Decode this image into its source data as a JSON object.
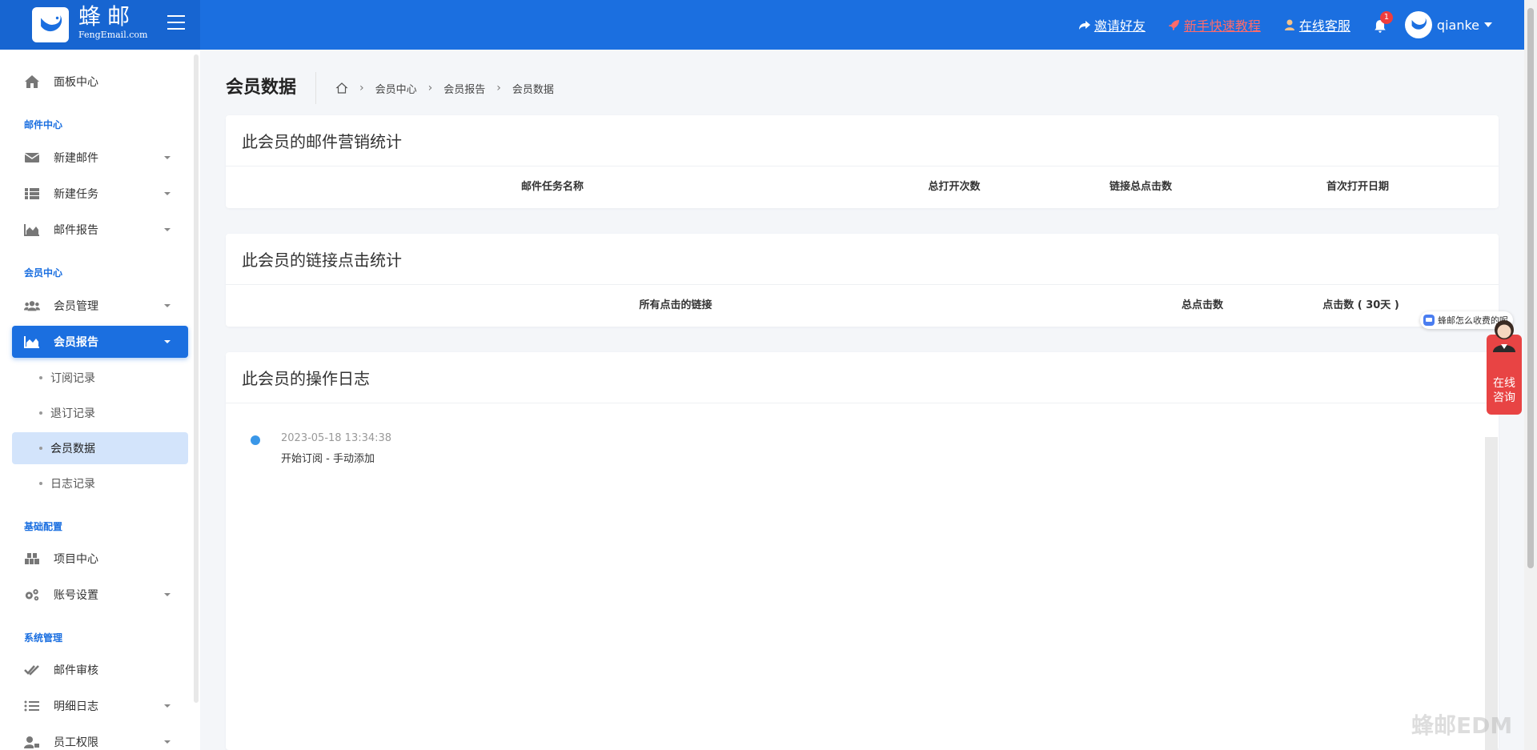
{
  "brand": {
    "name_cn": "蜂邮",
    "name_en": "FengEmail.com"
  },
  "header": {
    "links": [
      {
        "label": "邀请好友",
        "icon": "share-icon"
      },
      {
        "label": "新手快速教程",
        "icon": "rocket-icon",
        "color": "#ff6b6b"
      },
      {
        "label": "在线客服",
        "icon": "user-icon"
      }
    ],
    "notifications": "1",
    "username": "qianke"
  },
  "sidebar": {
    "dashboard": "面板中心",
    "sections": {
      "mail": "邮件中心",
      "member": "会员中心",
      "config": "基础配置",
      "system": "系统管理"
    },
    "items": {
      "new_mail": "新建邮件",
      "new_task": "新建任务",
      "mail_report": "邮件报告",
      "member_manage": "会员管理",
      "member_report": "会员报告",
      "project_center": "项目中心",
      "account_settings": "账号设置",
      "mail_review": "邮件审核",
      "detail_log": "明细日志",
      "staff_permission": "员工权限"
    },
    "subitems": {
      "subscribe_records": "订阅记录",
      "unsubscribe_records": "退订记录",
      "member_data": "会员数据",
      "log_records": "日志记录"
    }
  },
  "page": {
    "title": "会员数据",
    "breadcrumb": [
      "会员中心",
      "会员报告",
      "会员数据"
    ]
  },
  "cards": {
    "mail_stats": {
      "title": "此会员的邮件营销统计",
      "columns": [
        "邮件任务名称",
        "总打开次数",
        "链接总点击数",
        "首次打开日期"
      ]
    },
    "link_stats": {
      "title": "此会员的链接点击统计",
      "columns": [
        "所有点击的链接",
        "总点击数",
        "点击数 ( 30天 )"
      ]
    },
    "operation_log": {
      "title": "此会员的操作日志",
      "entries": [
        {
          "time": "2023-05-18 13:34:38",
          "text": "开始订阅 - 手动添加"
        }
      ]
    }
  },
  "widgets": {
    "pill_text": "蜂邮怎么收费的呢",
    "consult_line1": "在线",
    "consult_line2": "咨询",
    "watermark": "蜂邮EDM"
  },
  "colors": {
    "primary": "#1b6fe0",
    "danger": "#e84444",
    "active_sub_bg": "#d3e4fb"
  }
}
